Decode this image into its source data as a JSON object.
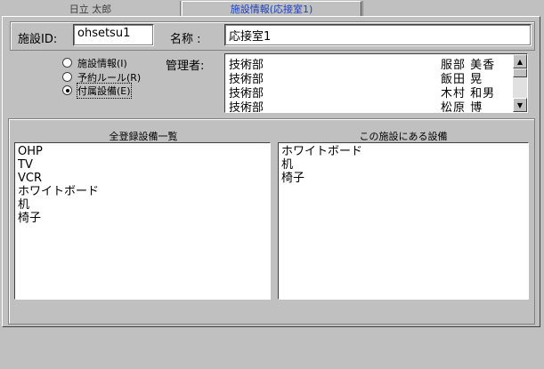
{
  "tabs": [
    {
      "label": "日立  太郎",
      "active": false
    },
    {
      "label": "施設情報(応接室1)",
      "active": true
    }
  ],
  "facility": {
    "id_label": "施設ID:",
    "id_value": "ohsetsu1",
    "name_label": "名称  :",
    "name_value": "応接室1"
  },
  "radios": [
    {
      "label": "施設情報(I)",
      "checked": false
    },
    {
      "label": "予約ルール(R)",
      "checked": false
    },
    {
      "label": "付属設備(E)",
      "checked": true
    }
  ],
  "manager": {
    "label": "管理者:",
    "rows": [
      {
        "dept": "技術部",
        "name": "服部  美香"
      },
      {
        "dept": "技術部",
        "name": "飯田  晃"
      },
      {
        "dept": "技術部",
        "name": "木村  和男"
      },
      {
        "dept": "技術部",
        "name": "松原  博"
      }
    ]
  },
  "all_equipment": {
    "title": "全登録設備一覧",
    "items": [
      "OHP",
      "TV",
      "VCR",
      "ホワイトボード",
      "机",
      "椅子"
    ]
  },
  "facility_equipment": {
    "title": "この施設にある設備",
    "items": [
      "ホワイトボード",
      "机",
      "椅子"
    ]
  },
  "colors": {
    "background": "#c0c0c0",
    "active_tab_text": "#2040c0"
  }
}
